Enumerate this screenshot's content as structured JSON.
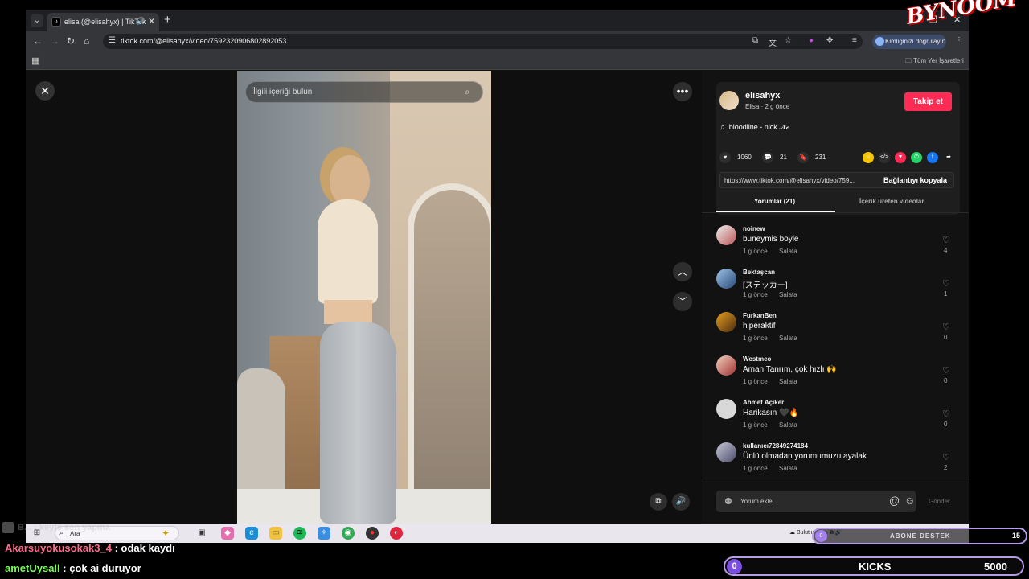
{
  "browser": {
    "tab_title": "elisa (@elisahyx) | TikTok",
    "url": "tiktok.com/@elisahyx/video/7592320906802892053",
    "profile_label": "Kimliğinizi doğrulayın",
    "bookmarks_label": "Tüm Yer İşaretleri"
  },
  "channel_logo": "BYNOOM",
  "video": {
    "search_placeholder": "İlgili içeriği bulun"
  },
  "post": {
    "username": "elisahyx",
    "subline": "Elisa · 2 g önce",
    "follow_label": "Takip et",
    "music": "bloodline - nick 𝒩𝒸",
    "likes": "1060",
    "comments": "21",
    "saves": "231",
    "link": "https://www.tiktok.com/@elisahyx/video/759...",
    "copy_label": "Bağlantıyı kopyala",
    "tabs": [
      "Yorumlar (21)",
      "İçerik üreten videolar"
    ]
  },
  "comments": [
    {
      "user": "noinew",
      "text": "buneymis böyle",
      "time": "1 g önce",
      "reply": "Salata",
      "likes": "4"
    },
    {
      "user": "Bektaşcan",
      "text": "[ステッカー]",
      "time": "1 g önce",
      "reply": "Salata",
      "likes": "1"
    },
    {
      "user": "FurkanBen",
      "text": "hiperaktif",
      "time": "1 g önce",
      "reply": "Salata",
      "likes": "0"
    },
    {
      "user": "Westmeo",
      "text": "Aman Tanrım, çok hızlı 🙌",
      "time": "1 g önce",
      "reply": "Salata",
      "likes": "0"
    },
    {
      "user": "Ahmet Açıker",
      "text": "Harikasın 🖤🔥",
      "time": "1 g önce",
      "reply": "Salata",
      "likes": "0"
    },
    {
      "user": "kullanıcı72849274184",
      "text": "Ünlü olmadan yorumumuzu ayalak",
      "time": "1 g önce",
      "reply": "Salata",
      "likes": "2"
    }
  ],
  "comment_input": {
    "placeholder": "Yorum ekle...",
    "send_label": "Gönder"
  },
  "taskbar": {
    "search_placeholder": "Ara",
    "tray_text": "Bulutlu"
  },
  "overlay": {
    "chat_ghost": "B... : keyfe sen yapma",
    "chat": [
      {
        "user": "Akarsuyokusokak3_4",
        "message": " : odak kaydı"
      },
      {
        "user": "ametUysall",
        "message": " : çok ai duruyor"
      }
    ],
    "abone_label": "ABONE DESTEK",
    "abone_current": "0",
    "abone_goal": "15",
    "kicks_label": "KICKS",
    "kicks_current": "0",
    "kicks_goal": "5000"
  },
  "colors": {
    "accent": "#fe2c55",
    "overlay_border": "#b69be6"
  }
}
